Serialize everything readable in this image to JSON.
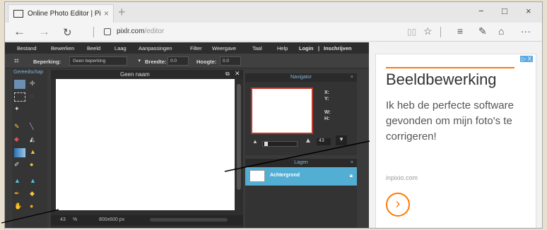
{
  "browser": {
    "tab_title": "Online Photo Editor | Pi",
    "tab_close": "×",
    "new_tab": "+",
    "url_host": "pixlr.com",
    "url_path": "/editor",
    "controls": {
      "minimize": "−",
      "maximize": "□",
      "close": "×"
    },
    "nav_icons": [
      "back-arrow-icon",
      "forward-arrow-icon",
      "refresh-icon"
    ],
    "toolbar_icons": [
      "reading-view-icon",
      "favorite-star-icon",
      "hub-icon",
      "web-note-icon",
      "share-icon",
      "more-icon"
    ]
  },
  "pixlr": {
    "menu": [
      "Bestand",
      "Bewerken",
      "Beeld",
      "Laag",
      "Aanpassingen",
      "Filter",
      "Weergave",
      "Taal",
      "Help",
      "Login",
      "|",
      "Inschrijven"
    ],
    "options": {
      "beperking_label": "Beperking:",
      "beperking_value": "Geen beperking",
      "breedte_label": "Breedte:",
      "breedte_value": "0.0",
      "hoogte_label": "Hoogte:",
      "hoogte_value": "0.0"
    },
    "tools_title": "Gereedschap",
    "document": {
      "title": "Geen naam",
      "zoom": "43",
      "zoom_unit": "%",
      "size": "800x600 px"
    },
    "navigator": {
      "title": "Navigator",
      "x_label": "X:",
      "y_label": "Y:",
      "w_label": "W:",
      "h_label": "H:",
      "zoom": "43"
    },
    "layers": {
      "title": "Lagen",
      "layer_name": "Achtergrond"
    }
  },
  "ad": {
    "badge": "▷ X",
    "title": "Beeldbewerking",
    "body": "Ik heb de perfecte software gevonden om mijn foto's te corrigeren!",
    "domain": "inpixio.com",
    "cta": "›",
    "accent": "#ff7a00"
  }
}
